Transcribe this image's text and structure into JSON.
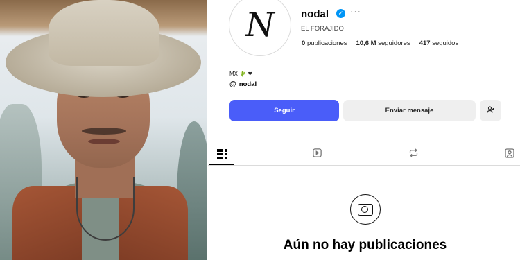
{
  "profile": {
    "avatar_text": "N",
    "username": "nodal",
    "full_name": "EL FORAJIDO",
    "stats": {
      "posts_count": "0",
      "posts_label": "publicaciones",
      "followers_count": "10,6 M",
      "followers_label": "seguidores",
      "following_count": "417",
      "following_label": "seguidos"
    },
    "bio": "MX 🌵 ❤",
    "threads_handle": "nodal"
  },
  "actions": {
    "follow_label": "Seguir",
    "message_label": "Enviar mensaje",
    "suggest_icon": "add-person-icon"
  },
  "tabs": [
    {
      "name": "posts",
      "icon": "grid-icon",
      "active": true
    },
    {
      "name": "reels",
      "icon": "reels-icon",
      "active": false
    },
    {
      "name": "reposts",
      "icon": "repost-icon",
      "active": false
    },
    {
      "name": "tagged",
      "icon": "tagged-icon",
      "active": false
    }
  ],
  "empty_state": {
    "icon": "camera-icon",
    "title": "Aún no hay publicaciones"
  },
  "colors": {
    "follow_button": "#4a5df9",
    "verified_badge": "#0095f6",
    "secondary_button": "#efefef"
  }
}
